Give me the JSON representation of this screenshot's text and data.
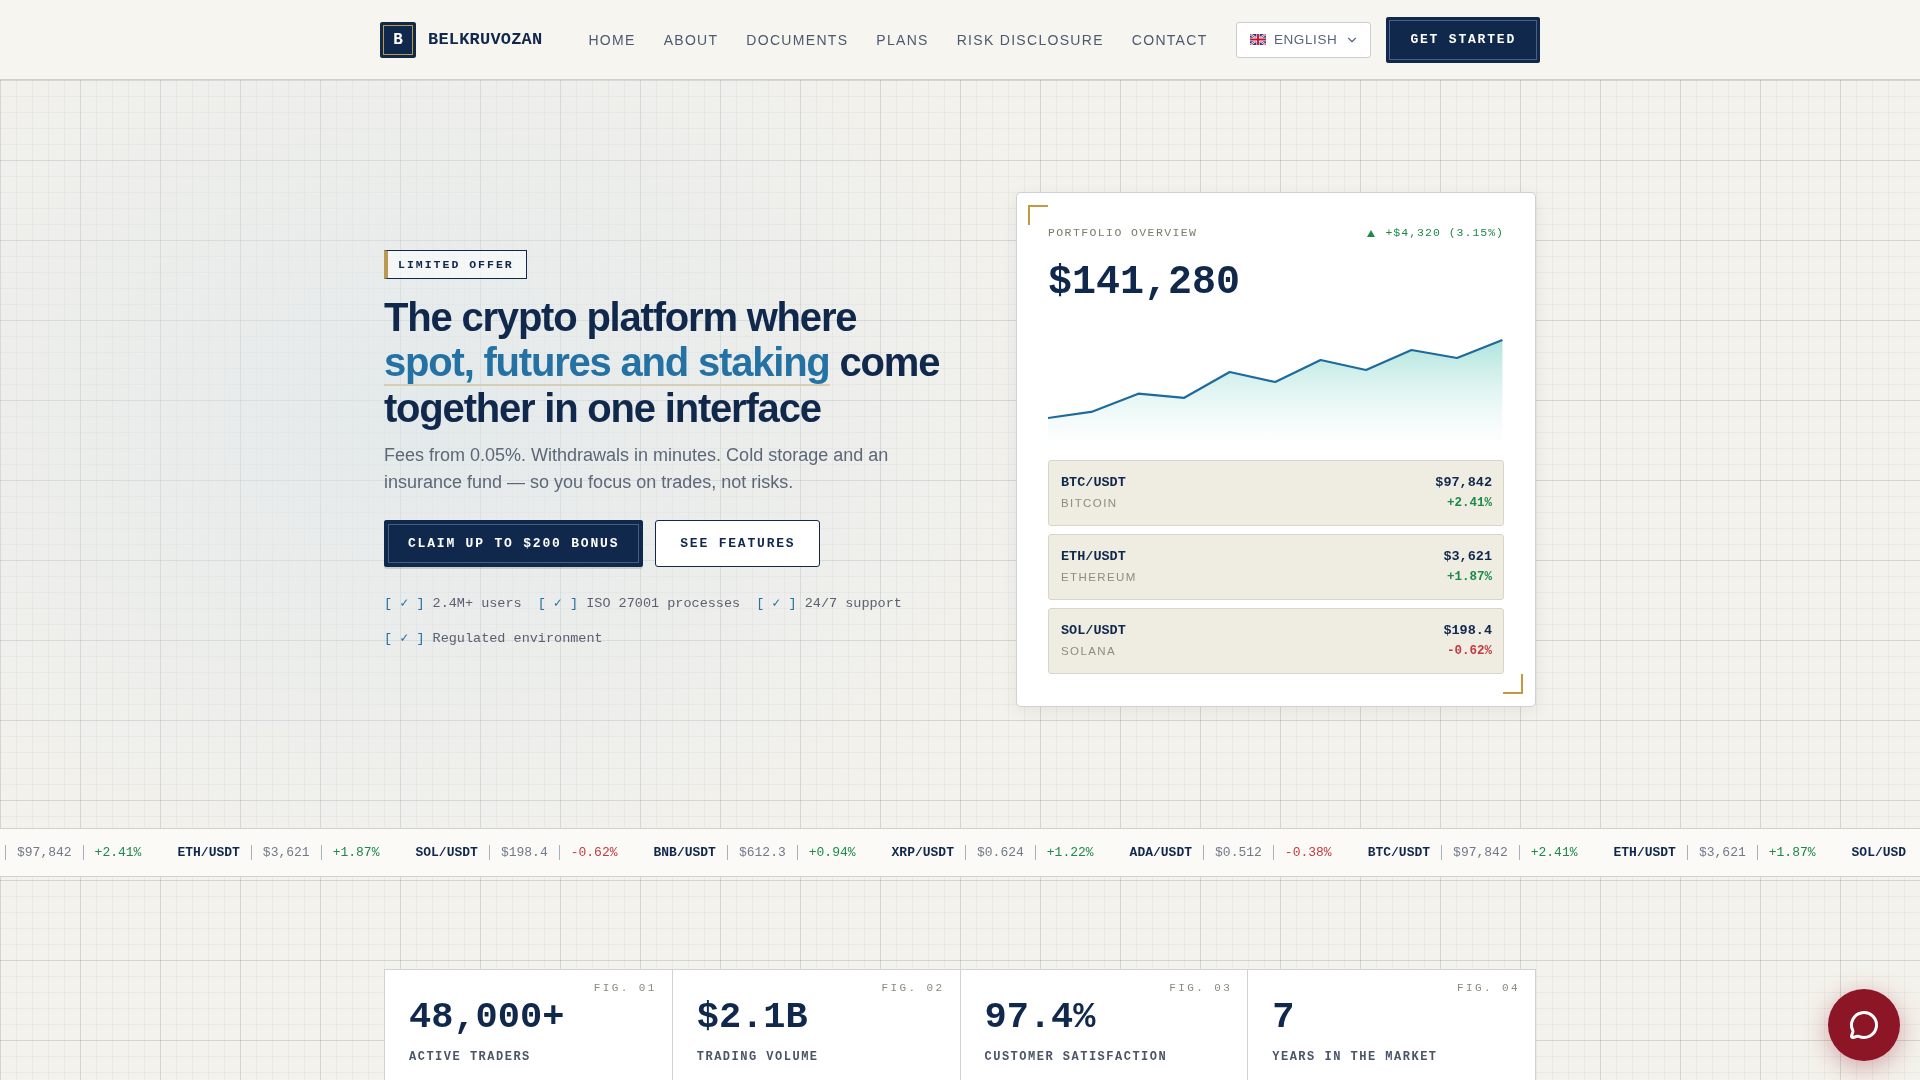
{
  "header": {
    "logo_mark": "B",
    "brand": "BELKRUVOZAN",
    "nav": [
      {
        "label": "HOME"
      },
      {
        "label": "ABOUT"
      },
      {
        "label": "DOCUMENTS"
      },
      {
        "label": "PLANS"
      },
      {
        "label": "RISK DISCLOSURE"
      },
      {
        "label": "CONTACT"
      }
    ],
    "language": {
      "label": "ENGLISH"
    },
    "cta": "GET STARTED"
  },
  "hero": {
    "badge": "LIMITED OFFER",
    "heading": {
      "lead": "The crypto platform where",
      "highlight": "spot, futures and staking",
      "tail": "come together in one interface"
    },
    "description": "Fees from 0.05%. Withdrawals in minutes. Cold storage and an insurance fund — so you focus on trades, not risks.",
    "buttons": [
      {
        "label": "CLAIM UP TO $200 BONUS",
        "kind": "primary"
      },
      {
        "label": "SEE FEATURES",
        "kind": "secondary"
      }
    ],
    "features": [
      {
        "mark": "[ ✓ ]",
        "label": "2.4M+ users"
      },
      {
        "mark": "[ ✓ ]",
        "label": "ISO 27001 processes"
      },
      {
        "mark": "[ ✓ ]",
        "label": "24/7 support"
      },
      {
        "mark": "[ ✓ ]",
        "label": "Regulated environment"
      }
    ]
  },
  "portfolio": {
    "title": "PORTFOLIO OVERVIEW",
    "change": {
      "text": "+$4,320 (3.15%)",
      "rising": true
    },
    "value": "$141,280",
    "assets": [
      {
        "pair": "BTC/USDT",
        "name": "BITCOIN",
        "price": "$97,842",
        "change": "+2.41%",
        "rising": true
      },
      {
        "pair": "ETH/USDT",
        "name": "ETHEREUM",
        "price": "$3,621",
        "change": "+1.87%",
        "rising": true
      },
      {
        "pair": "SOL/USDT",
        "name": "SOLANA",
        "price": "$198.4",
        "change": "-0.62%",
        "rising": false
      }
    ]
  },
  "ticker": [
    {
      "price": "$97,842",
      "change": "+2.41%",
      "rising": true
    },
    {
      "pair": "ETH/USDT",
      "price": "$3,621",
      "change": "+1.87%",
      "rising": true
    },
    {
      "pair": "SOL/USDT",
      "price": "$198.4",
      "change": "-0.62%",
      "rising": false
    },
    {
      "pair": "BNB/USDT",
      "price": "$612.3",
      "change": "+0.94%",
      "rising": true
    },
    {
      "pair": "XRP/USDT",
      "price": "$0.624",
      "change": "+1.22%",
      "rising": true
    },
    {
      "pair": "ADA/USDT",
      "price": "$0.512",
      "change": "-0.38%",
      "rising": false
    },
    {
      "pair": "BTC/USDT",
      "price": "$97,842",
      "change": "+2.41%",
      "rising": true
    },
    {
      "pair": "ETH/USDT",
      "price": "$3,621",
      "change": "+1.87%",
      "rising": true
    },
    {
      "pair": "SOL/USD"
    }
  ],
  "stats": [
    {
      "fig": "FIG. 01",
      "value": "48,000+",
      "label": "ACTIVE TRADERS"
    },
    {
      "fig": "FIG. 02",
      "value": "$2.1B",
      "label": "TRADING VOLUME"
    },
    {
      "fig": "FIG. 03",
      "value": "97.4%",
      "label": "CUSTOMER SATISFACTION"
    },
    {
      "fig": "FIG. 04",
      "value": "7",
      "label": "YEARS IN THE MARKET"
    }
  ]
}
